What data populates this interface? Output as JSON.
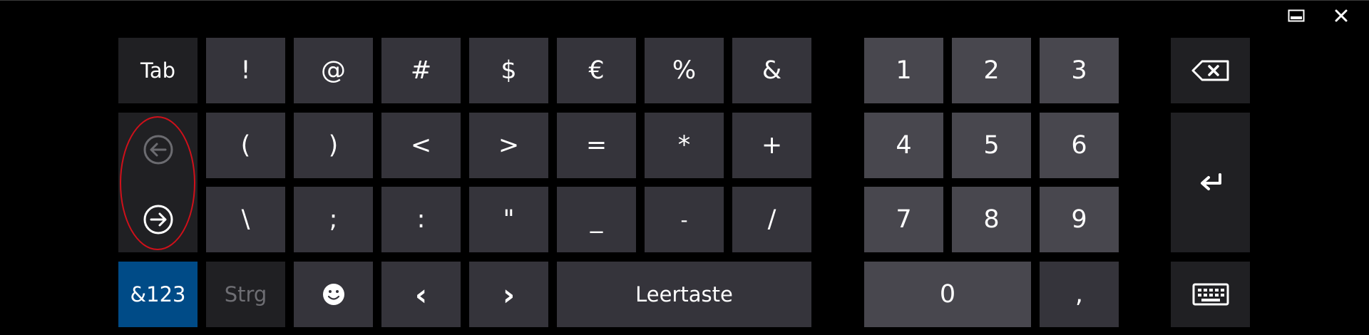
{
  "window": {
    "minimize_icon": "minimize-icon",
    "close_icon": "close-icon"
  },
  "colors": {
    "background": "#000000",
    "key": "#35343b",
    "key_dark": "#202023",
    "key_numpad": "#48474e",
    "accent": "#004b87",
    "annotation": "#d0101a"
  },
  "keys": {
    "tab": "Tab",
    "row1": [
      "!",
      "@",
      "#",
      "$",
      "€",
      "%",
      "&"
    ],
    "row2": [
      "(",
      ")",
      "<",
      ">",
      "=",
      "*",
      "+"
    ],
    "row3": [
      "\\",
      ";",
      ":",
      "\"",
      "_",
      "-",
      "/"
    ],
    "prev_icon": "circle-arrow-left-icon",
    "next_icon": "circle-arrow-right-icon",
    "mode_toggle": "&123",
    "ctrl": "Strg",
    "emoji_icon": "smiley-icon",
    "cursor_left": "‹",
    "cursor_right": "›",
    "space": "Leertaste",
    "numpad": [
      "1",
      "2",
      "3",
      "4",
      "5",
      "6",
      "7",
      "8",
      "9"
    ],
    "zero": "0",
    "comma": ",",
    "backspace_icon": "backspace-icon",
    "enter_icon": "enter-icon",
    "keyboard_icon": "keyboard-icon"
  }
}
